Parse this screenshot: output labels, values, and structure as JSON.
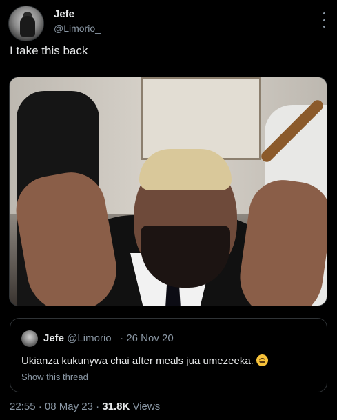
{
  "author": {
    "display_name": "Jefe",
    "handle": "@Limorio_"
  },
  "tweet": {
    "text": "I take this back"
  },
  "quoted_tweet": {
    "display_name": "Jefe",
    "handle": "@Limorio_",
    "separator": "·",
    "date": "26 Nov 20",
    "text": "Ukianza kukunywa chai after meals jua umezeeka.",
    "emoji": "smiling-face-emoji",
    "show_thread_label": "Show this thread"
  },
  "footer": {
    "time": "22:55",
    "separator": "·",
    "date": "08 May 23",
    "views_count": "31.8K",
    "views_label": "Views"
  },
  "icons": {
    "more": "more-vertical-icon"
  }
}
